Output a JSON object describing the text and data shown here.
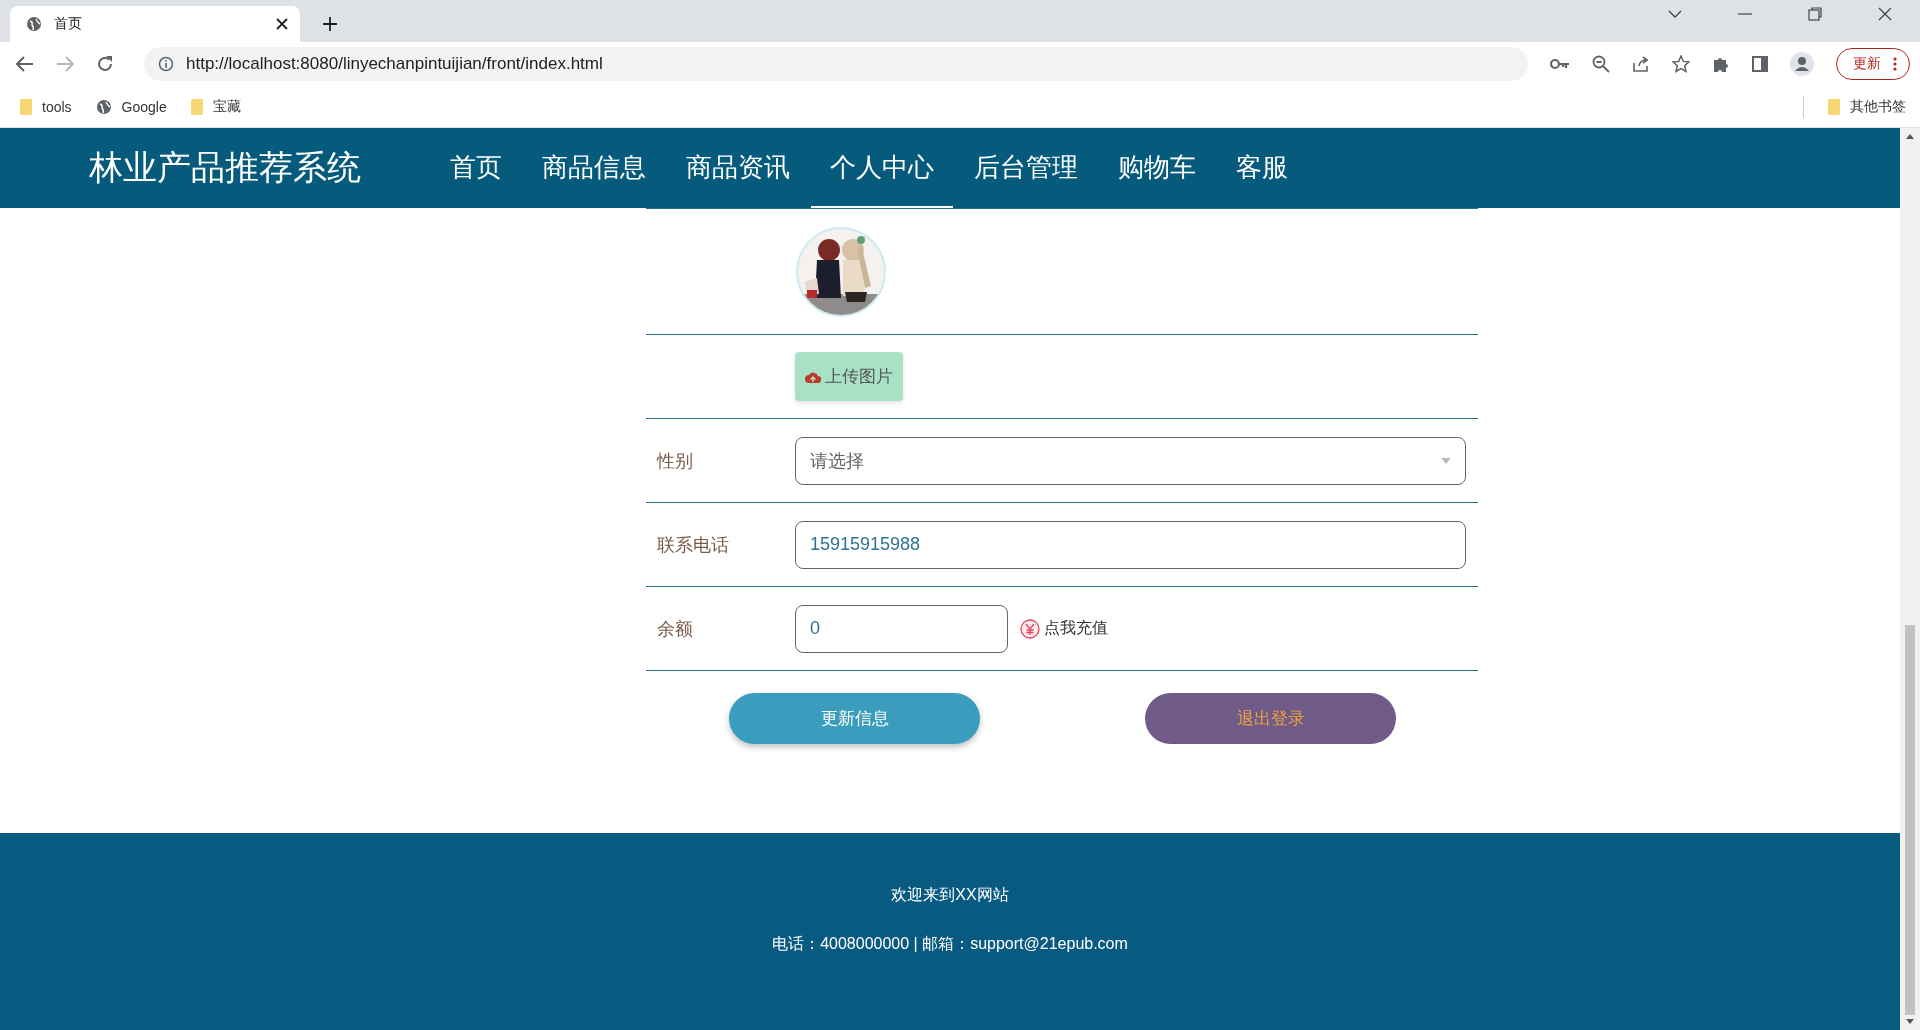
{
  "browser": {
    "tab_title": "首页",
    "url": "http://localhost:8080/linyechanpintuijian/front/index.html",
    "update_button": "更新",
    "bookmarks": [
      {
        "label": "tools",
        "kind": "folder"
      },
      {
        "label": "Google",
        "kind": "site"
      },
      {
        "label": "宝藏",
        "kind": "folder"
      }
    ],
    "other_bookmarks": "其他书签"
  },
  "header": {
    "site_title": "林业产品推荐系统",
    "nav": [
      {
        "label": "首页",
        "selected": false
      },
      {
        "label": "商品信息",
        "selected": false
      },
      {
        "label": "商品资讯",
        "selected": false
      },
      {
        "label": "个人中心",
        "selected": true
      },
      {
        "label": "后台管理",
        "selected": false
      },
      {
        "label": "购物车",
        "selected": false
      },
      {
        "label": "客服",
        "selected": false
      }
    ]
  },
  "profile": {
    "upload_button": "上传图片",
    "fields": [
      {
        "kind": "select",
        "label": "性别",
        "placeholder": "请选择"
      },
      {
        "kind": "input",
        "label": "联系电话",
        "value": "15915915988"
      },
      {
        "kind": "balance",
        "label": "余额",
        "value": "0",
        "recharge_link": "点我充值"
      }
    ],
    "actions": [
      {
        "kind": "primary",
        "label": "更新信息"
      },
      {
        "kind": "secondary",
        "label": "退出登录"
      }
    ]
  },
  "footer": {
    "welcome": "欢迎来到XX网站",
    "contact": "电话：4008000000 | 邮箱：support@21epub.com"
  }
}
